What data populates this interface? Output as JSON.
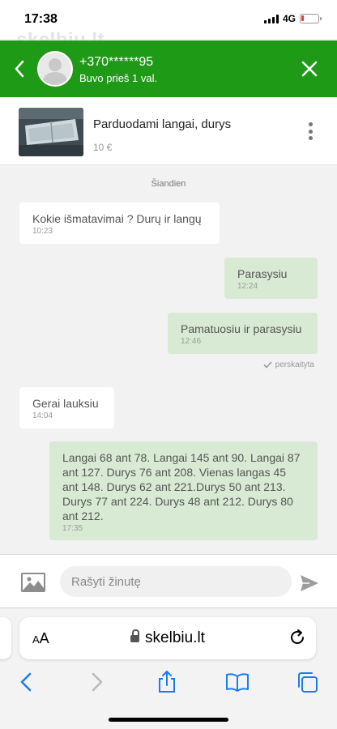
{
  "status_bar": {
    "time": "17:38",
    "network": "4G"
  },
  "watermark": {
    "text": "skelbiu.lt"
  },
  "header": {
    "contact_name": "+370******95",
    "contact_status": "Buvo prieš 1 val."
  },
  "listing": {
    "title": "Parduodami langai, durys",
    "price": "10 €"
  },
  "chat": {
    "date_label": "Šiandien",
    "messages": [
      {
        "direction": "in",
        "text": "Kokie išmatavimai ? Durų ir langų",
        "time": "10:23"
      },
      {
        "direction": "out",
        "text": "Parasysiu",
        "time": "12:24"
      },
      {
        "direction": "out",
        "text": "Pamatuosiu ir parasysiu",
        "time": "12:46"
      },
      {
        "direction": "in",
        "text": "Gerai lauksiu",
        "time": "14:04"
      },
      {
        "direction": "out",
        "text": "Langai 68 ant 78. Langai 145 ant 90. Langai 87 ant 127. Durys 76 ant 208. Vienas langas 45 ant 148. Durys 62 ant 221.Durys 50 ant 213. Durys 77 ant 224. Durys 48 ant 212. Durys 80 ant 212.",
        "time": "17:35"
      }
    ],
    "read_label": "perskaityta"
  },
  "composer": {
    "placeholder": "Rašyti žinutę"
  },
  "browser": {
    "aa_small": "A",
    "aa_large": "A",
    "url": "skelbiu.lt"
  },
  "colors": {
    "brand_green": "#1f9a17",
    "outgoing_bubble": "#d8ead3",
    "ios_blue": "#1a7cf5"
  },
  "icons": [
    "back-icon",
    "avatar",
    "close-icon",
    "kebab-icon",
    "checkmark-icon",
    "image-icon",
    "send-icon",
    "lock-icon",
    "reload-icon",
    "safari-back-icon",
    "safari-forward-icon",
    "share-icon",
    "bookmarks-icon",
    "tabs-icon"
  ]
}
